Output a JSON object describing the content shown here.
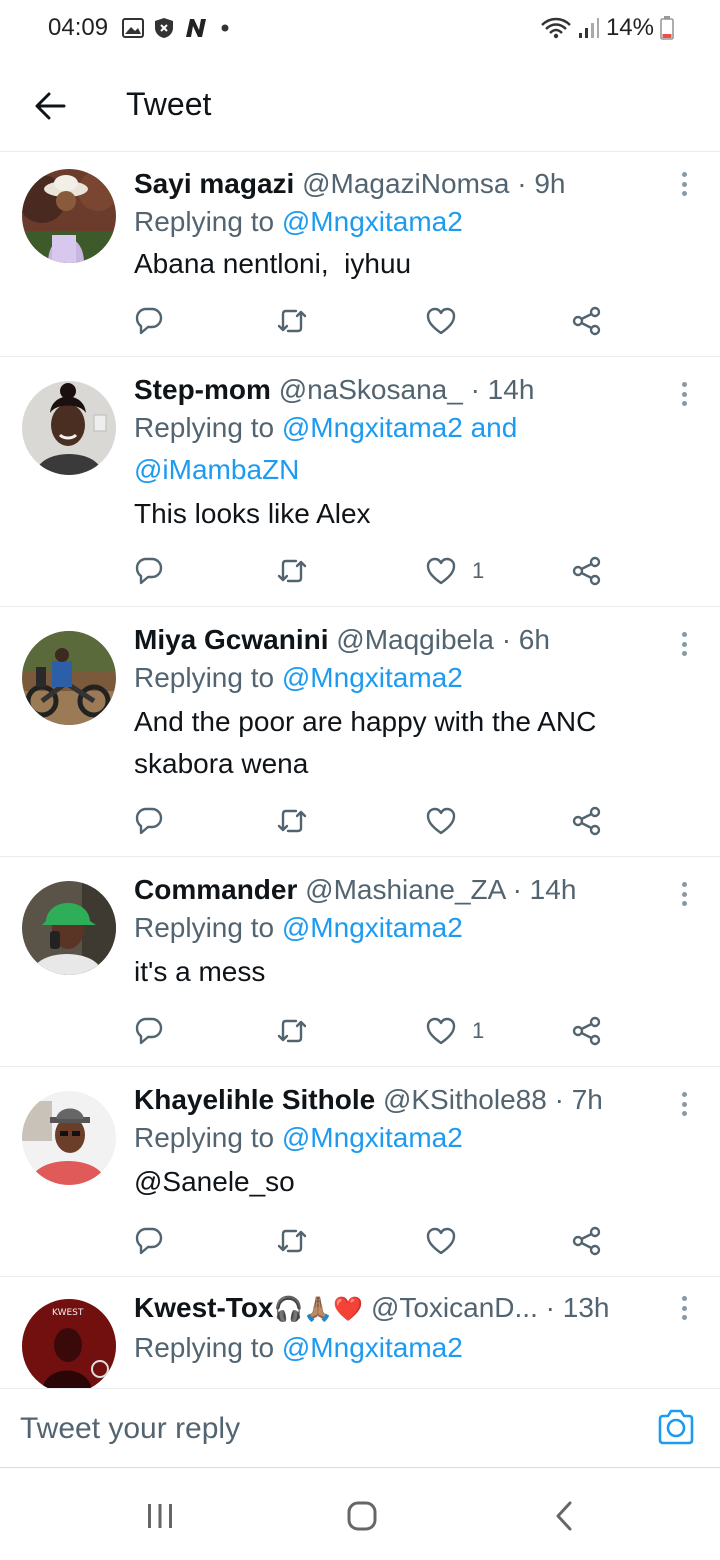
{
  "status_bar": {
    "time": "04:09",
    "battery": "14%",
    "left_icons": [
      "gallery-icon",
      "shield-icon",
      "news-n-icon",
      "dot-icon"
    ],
    "right_icons": [
      "wifi-icon",
      "signal-icon",
      "battery-icon"
    ]
  },
  "header": {
    "title": "Tweet",
    "back_icon": "arrow-left-icon"
  },
  "tweets": [
    {
      "name": "Sayi magazi",
      "handle": "@MagaziNomsa",
      "time": "· 9h",
      "replying_prefix": "Replying to ",
      "replying_to": "@Mngxitama2",
      "replying_more": "",
      "text_lines": [
        "Abana nentloni,  iyhuu"
      ],
      "like_count": ""
    },
    {
      "name": "Step-mom",
      "handle": "@naSkosana_",
      "time": "· 14h",
      "replying_prefix": "Replying to ",
      "replying_to": "@Mngxitama2 and",
      "replying_more": "@iMambaZN",
      "text_lines": [
        "This looks like Alex"
      ],
      "like_count": "1"
    },
    {
      "name": "Miya Gcwanini",
      "handle": "@Maqgibela",
      "time": "· 6h",
      "replying_prefix": "Replying to ",
      "replying_to": "@Mngxitama2",
      "replying_more": "",
      "text_lines": [
        "And the poor are happy with the ANC",
        "skabora wena"
      ],
      "like_count": ""
    },
    {
      "name": "Commander",
      "handle": "@Mashiane_ZA",
      "time": "· 14h",
      "replying_prefix": "Replying to ",
      "replying_to": "@Mngxitama2",
      "replying_more": "",
      "text_lines": [
        "it's a mess"
      ],
      "like_count": "1"
    },
    {
      "name": "Khayelihle Sithole",
      "handle": "@KSithole88",
      "time": "· 7h",
      "replying_prefix": "Replying to ",
      "replying_to": "@Mngxitama2",
      "replying_more": "",
      "text_lines": [
        "@Sanele_so"
      ],
      "like_count": ""
    },
    {
      "name": "Kwest-Tox",
      "name_emoji": "🎧🙏🏽❤️",
      "handle": "@ToxicanD...",
      "time": "· 13h",
      "replying_prefix": "Replying to ",
      "replying_to": "@Mngxitama2",
      "replying_more": "",
      "text_lines": [],
      "like_count": ""
    }
  ],
  "action_icons": [
    "reply-icon",
    "retweet-icon",
    "like-icon",
    "share-icon"
  ],
  "composer": {
    "placeholder": "Tweet your reply",
    "camera_icon": "camera-icon"
  },
  "nav_bar": {
    "icons": [
      "recent-apps-icon",
      "home-icon",
      "back-icon"
    ]
  },
  "colors": {
    "accent": "#1d9bf0",
    "text_primary": "#0f1419",
    "text_secondary": "#536471",
    "divider": "#e6ecf0",
    "heart": "#e0245e"
  }
}
